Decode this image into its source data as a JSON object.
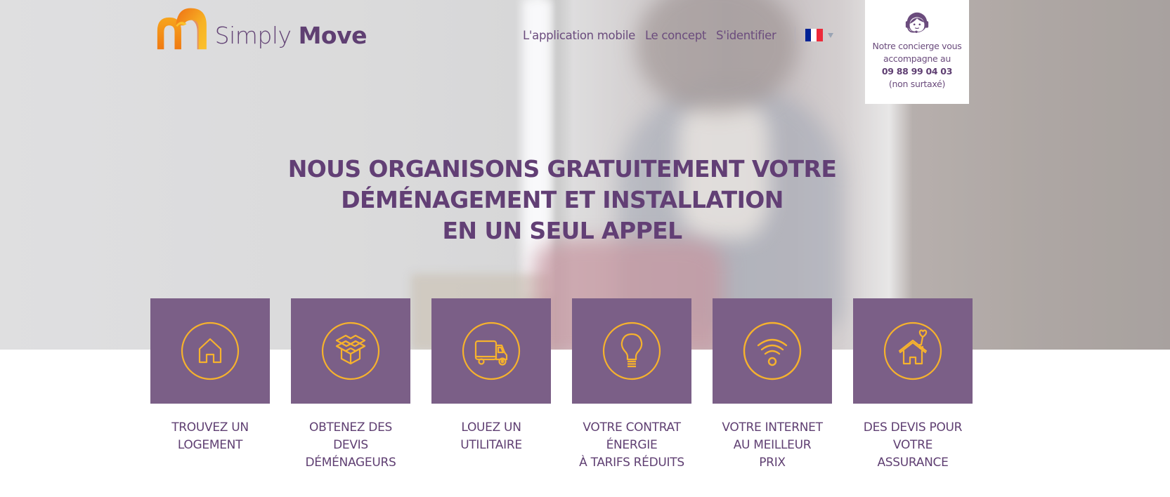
{
  "brand": {
    "name_light": "Simply",
    "name_bold": "Move",
    "logo_icon": "simply-move-logo-icon",
    "colors": {
      "primary": "#623f75",
      "tile": "#7b5f87",
      "accent": "#f6b22d",
      "logo_orange": "#f08a1c"
    }
  },
  "nav": {
    "items": [
      {
        "label": "L'application mobile"
      },
      {
        "label": "Le concept"
      },
      {
        "label": "S'identifier"
      }
    ],
    "language": {
      "icon": "france-flag-icon",
      "caret": "caret-down-icon"
    }
  },
  "concierge": {
    "icon": "headset-agent-icon",
    "line1": "Notre concierge vous",
    "line2": "accompagne au",
    "phone": "09 88 99 04 03",
    "note": "(non surtaxé)"
  },
  "hero": {
    "headline": [
      "NOUS ORGANISONS GRATUITEMENT VOTRE",
      "DÉMÉNAGEMENT ET INSTALLATION",
      "EN UN SEUL APPEL"
    ]
  },
  "services": [
    {
      "icon": "house-icon",
      "lines": [
        "TROUVEZ UN",
        "LOGEMENT"
      ]
    },
    {
      "icon": "open-box-icon",
      "lines": [
        "OBTENEZ DES",
        "DEVIS",
        "DÉMÉNAGEURS"
      ]
    },
    {
      "icon": "truck-icon",
      "lines": [
        "LOUEZ UN",
        "UTILITAIRE"
      ]
    },
    {
      "icon": "lightbulb-icon",
      "lines": [
        "VOTRE CONTRAT",
        "ÉNERGIE",
        "À TARIFS RÉDUITS"
      ]
    },
    {
      "icon": "wifi-icon",
      "lines": [
        "VOTRE INTERNET",
        "AU MEILLEUR",
        "PRIX"
      ]
    },
    {
      "icon": "house-heart-icon",
      "lines": [
        "DES DEVIS POUR",
        "VOTRE",
        "ASSURANCE"
      ]
    }
  ]
}
